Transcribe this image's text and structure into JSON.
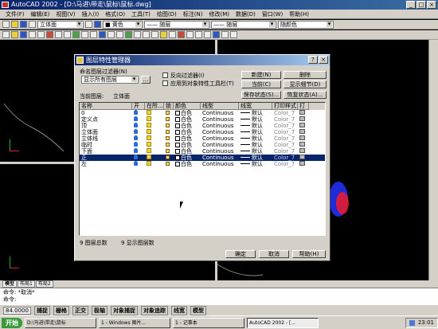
{
  "window": {
    "title": "AutoCAD 2002 - [D:\\马进\\带走\\鼠标\\鼠标.dwg]"
  },
  "menu": [
    "文件(F)",
    "编辑(E)",
    "视图(V)",
    "插入(I)",
    "格式(O)",
    "工具(T)",
    "绘图(D)",
    "标注(N)",
    "修改(M)",
    "数据(D)",
    "窗口(W)",
    "帮助(H)"
  ],
  "toolbar2": {
    "layer_combo": "立体面",
    "color_combo": "■ 黄色",
    "linetype_combo": "—— 随层",
    "lineweight_combo": "—— 随层",
    "plotstyle_combo": "随颜色"
  },
  "dialog": {
    "title": "图层特性管理器",
    "filter_label": "命名图层过滤器(N)",
    "filter_value": "显示所有图层",
    "invert_label": "反向过滤器(I)",
    "apply_label": "应用到对象特性工具栏(T)",
    "btn_new": "新建(N)",
    "btn_delete": "删除",
    "btn_current": "当前(C)",
    "btn_details": "显示细节(D)",
    "btn_save": "保存状态(S)...",
    "btn_restore": "恢复状态(A)...",
    "current_label": "当前图层:",
    "current_value": "立体面",
    "columns": [
      "名称",
      "开",
      "在所...",
      "锁",
      "颜色",
      "线型",
      "线宽",
      "打印样式",
      "打"
    ],
    "rows": [
      {
        "name": "0",
        "color": "白色",
        "linetype": "Continuous",
        "lineweight": "默认",
        "plotstyle": "Color_7",
        "selected": false
      },
      {
        "name": "定义点",
        "color": "白色",
        "linetype": "Continuous",
        "lineweight": "默认",
        "plotstyle": "Color_7",
        "selected": false
      },
      {
        "name": "顶",
        "color": "白色",
        "linetype": "Continuous",
        "lineweight": "默认",
        "plotstyle": "Color_7",
        "selected": false
      },
      {
        "name": "立体面",
        "color": "白色",
        "linetype": "Continuous",
        "lineweight": "默认",
        "plotstyle": "Color_7",
        "selected": false
      },
      {
        "name": "立体线",
        "color": "白色",
        "linetype": "Continuous",
        "lineweight": "默认",
        "plotstyle": "Color_7",
        "selected": false
      },
      {
        "name": "临时",
        "color": "白色",
        "linetype": "Continuous",
        "lineweight": "默认",
        "plotstyle": "Color_7",
        "selected": false
      },
      {
        "name": "下面",
        "color": "白色",
        "linetype": "Continuous",
        "lineweight": "默认",
        "plotstyle": "Color_7",
        "selected": false
      },
      {
        "name": "正",
        "color": "白色",
        "linetype": "Continuous",
        "lineweight": "默认",
        "plotstyle": "Color_7",
        "selected": true
      },
      {
        "name": "左",
        "color": "白色",
        "linetype": "Continuous",
        "lineweight": "默认",
        "plotstyle": "Color_7",
        "selected": false
      }
    ],
    "total_text": "9 图层总数",
    "shown_text": "9 显示图层数",
    "btn_ok": "确定",
    "btn_cancel": "取消",
    "btn_help": "帮助(H)"
  },
  "tabs": [
    "模型",
    "布局1",
    "布局2"
  ],
  "command": {
    "line1": "命令: *取消*",
    "line2": "命令:"
  },
  "status": {
    "coords": "84.0000",
    "modes": [
      "捕捉",
      "栅格",
      "正交",
      "极轴",
      "对象捕捉",
      "对象追踪",
      "线宽",
      "模型"
    ]
  },
  "taskbar": {
    "start": "开始",
    "tasks": [
      "D:\\马进\\带走\\鼠标",
      "1 - Windows 图片...",
      "1 - 记事本",
      "AutoCAD 2002 - [..."
    ],
    "clock": "23:01"
  }
}
